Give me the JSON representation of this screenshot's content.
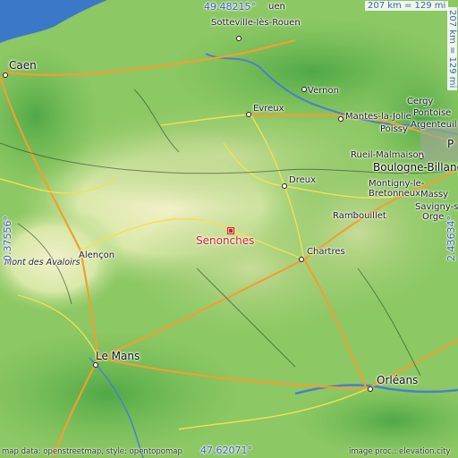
{
  "map": {
    "place": "Senonches",
    "coords": {
      "top": "49.48215°",
      "bottom": "47.62071°",
      "left": "-0.37556°",
      "right": "2.43634°"
    },
    "scale": {
      "horizontal": "207 km = 129 mi",
      "vertical": "207 km = 129 mi"
    },
    "credits": {
      "left": "map data: openstreetmap, style: opentopomap",
      "right": "image proc.: elevation.city"
    },
    "cities": {
      "caen": "Caen",
      "rouen": "uen",
      "sotteville": "Sotteville-lès-Rouen",
      "vernon": "Vernon",
      "evreux": "Evreux",
      "cergy": "Cergy",
      "pontoise": "Pontoise",
      "argenteuil": "Argenteuil",
      "mantes": "Mantes-la-Jolie",
      "poissy": "Poissy",
      "rueil": "Rueil-Malmaison",
      "boulogne": "Boulogne-Billanc",
      "dreux": "Dreux",
      "montigny": "Montigny-le-\nBretonneux",
      "massy": "Massy",
      "savigny": "Savigny-sur-\nOrge",
      "rambouillet": "Rambouillet",
      "chartres": "Chartres",
      "alencon": "Alençon",
      "avaloirs": "Mont des Avaloirs",
      "lemans": "Le Mans",
      "orleans": "Orléans",
      "paris": "P"
    },
    "colors": {
      "lowland": "#8cc864",
      "upland": "#d8e8a8",
      "sea": "#3c78c8",
      "river": "#4a7fd0",
      "road_major": "#f0a030",
      "road_minor": "#f5e050",
      "focus": "#d21e1e",
      "coord_text": "#3a5ec8"
    }
  }
}
